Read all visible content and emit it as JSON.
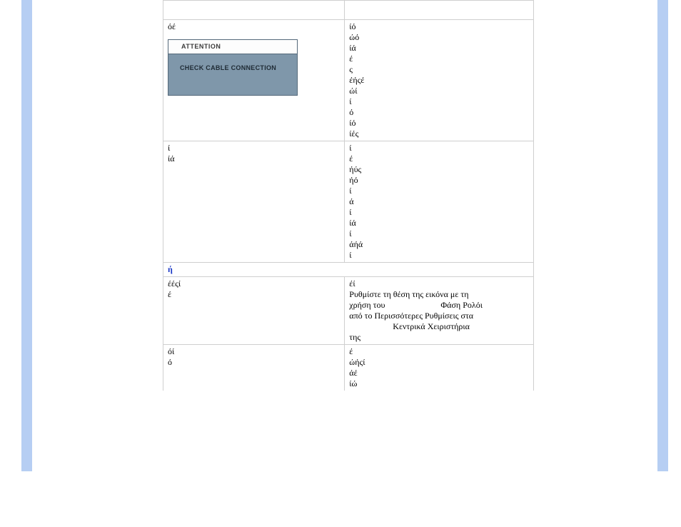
{
  "attention": {
    "headline": "ATTENTION",
    "message": "CHECK CABLE CONNECTION"
  },
  "rows": {
    "stubLeft": " ",
    "stubRight": " ",
    "r1": {
      "leftLines": [
        "",
        "",
        "",
        "όέ"
      ],
      "rightLines": [
        "ίό",
        "ώό",
        "ίά",
        "έ",
        "ς",
        "έήςέ",
        "ώί",
        "ί",
        "ό",
        "ίό",
        "ίές"
      ]
    },
    "r2": {
      "leftLines": [
        "",
        "",
        "",
        "",
        "",
        "",
        "ί",
        "ίά"
      ],
      "rightLines": [
        "ί",
        "έ",
        "ήύς",
        "ήό",
        "ί",
        "ά",
        "",
        "ί",
        "ίά",
        "ί",
        "άήά",
        "ί"
      ]
    },
    "sectionHeader": "ή",
    "r3": {
      "leftLines": [
        "",
        "",
        "έέςί",
        "έ"
      ],
      "rightLine1": "έί",
      "rightLine2a": "Ρυθμίστε τη θέση της εικόνα με τη ",
      "rightLine2b": "χρήση του ",
      "rightLine2c": "Φάση Ρολόι ",
      "rightLine3a": "από το Περισσότερες Ρυθμίσεις στα ",
      "rightLine3b": "Κεντρικά Χειριστήρια ",
      "rightLine4": "της "
    },
    "r4": {
      "leftLines": [
        "",
        "",
        "όί",
        "ό"
      ],
      "rightLines": [
        "έ",
        "ώήςί",
        "άέ",
        "ίώ"
      ]
    }
  }
}
